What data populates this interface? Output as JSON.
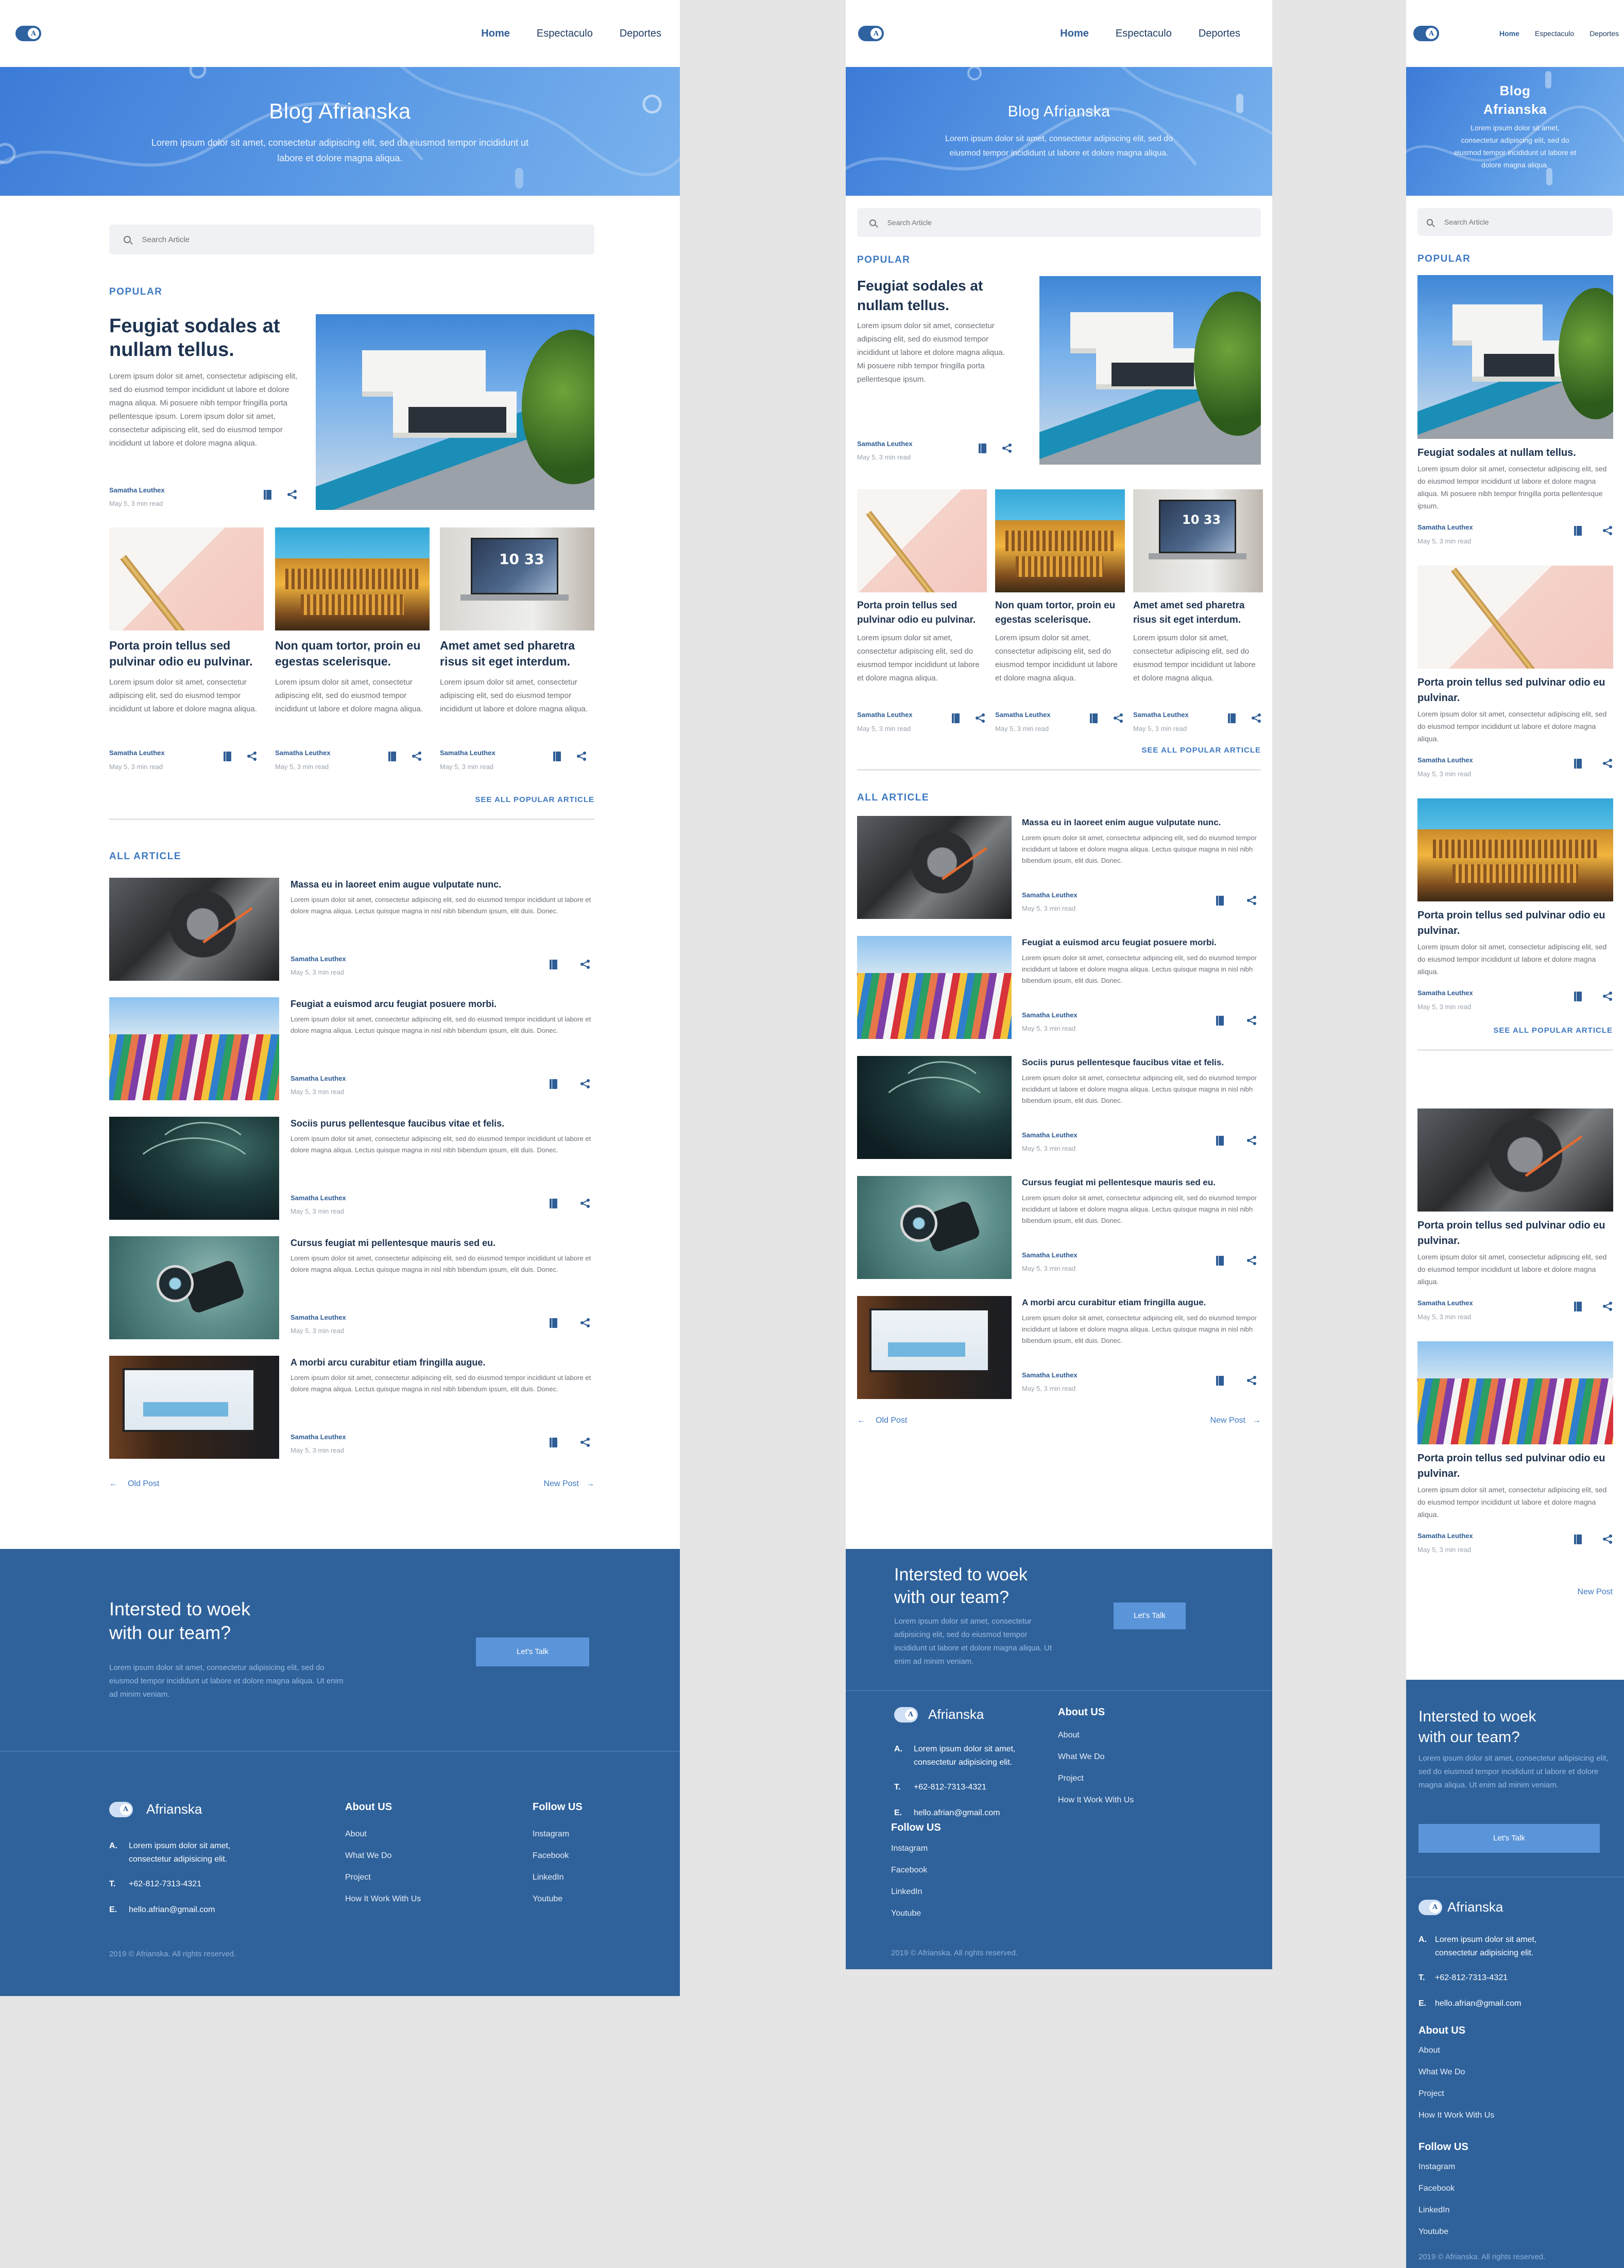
{
  "brand": {
    "name": "Afrianska",
    "logo_glyph": "A",
    "primary": "#2f629b",
    "accent": "#3d78c1"
  },
  "nav": {
    "items": [
      "Home",
      "Espectaculo",
      "Deportes"
    ],
    "active": "Home"
  },
  "hero": {
    "title": "Blog Afrianska",
    "subtitle": "Lorem ipsum dolor sit amet, consectetur adipiscing elit, sed do eiusmod tempor incididunt ut labore et dolore magna aliqua.",
    "mobile_title_line1": "Blog",
    "mobile_title_line2": "Afrianska"
  },
  "search": {
    "placeholder": "Search Article"
  },
  "popular": {
    "label": "POPULAR",
    "featured": {
      "title": "Feugiat sodales at nullam tellus.",
      "body_desktop": "Lorem ipsum dolor sit amet, consectetur adipiscing elit, sed do eiusmod tempor incididunt ut labore et dolore magna aliqua. Mi posuere nibh tempor fringilla porta pellentesque ipsum. Lorem ipsum dolor sit amet, consectetur adipiscing elit, sed do eiusmod tempor incididunt ut labore et dolore magna aliqua.",
      "body_tablet": "Lorem ipsum dolor sit amet, consectetur adipiscing elit, sed do eiusmod tempor incididunt ut labore et dolore magna aliqua. Mi posuere nibh tempor fringilla porta pellentesque ipsum.",
      "author": "Samatha Leuthex",
      "meta": "May 5, 3 min read",
      "image": "house"
    },
    "cards": [
      {
        "title": "Porta proin tellus sed pulvinar odio eu pulvinar.",
        "body": "Lorem ipsum dolor sit amet, consectetur adipiscing elit, sed do eiusmod tempor incididunt ut labore et dolore magna aliqua.",
        "author": "Samatha Leuthex",
        "meta": "May 5, 3 min read",
        "image": "pen"
      },
      {
        "title": "Non quam tortor, proin eu egestas scelerisque.",
        "body": "Lorem ipsum dolor sit amet, consectetur adipiscing elit, sed do eiusmod tempor incididunt ut labore et dolore magna aliqua.",
        "author": "Samatha Leuthex",
        "meta": "May 5, 3 min read",
        "image": "temple"
      },
      {
        "title": "Amet amet sed pharetra risus sit eget interdum.",
        "body": "Lorem ipsum dolor sit amet, consectetur adipiscing elit, sed do eiusmod tempor incididunt ut labore et dolore magna aliqua.",
        "author": "Samatha Leuthex",
        "meta": "May 5, 3 min read",
        "image": "laptop"
      }
    ],
    "see_all": "SEE ALL POPULAR ARTICLE"
  },
  "all_articles": {
    "label": "ALL ARTICLE",
    "items": [
      {
        "title": "Massa eu in laoreet enim augue vulputate nunc.",
        "body": "Lorem ipsum dolor sit amet, consectetur adipiscing elit, sed do eiusmod tempor incididunt ut labore et dolore magna aliqua. Lectus quisque magna in nisl nibh bibendum ipsum, elit duis. Donec.",
        "author": "Samatha Leuthex",
        "meta": "May 5, 3 min read",
        "image": "car"
      },
      {
        "title": "Feugiat a euismod arcu feugiat posuere morbi.",
        "body": "Lorem ipsum dolor sit amet, consectetur adipiscing elit, sed do eiusmod tempor incididunt ut labore et dolore magna aliqua. Lectus quisque magna in nisl nibh bibendum ipsum, elit duis. Donec.",
        "author": "Samatha Leuthex",
        "meta": "May 5, 3 min read",
        "image": "wall"
      },
      {
        "title": "Sociis purus pellentesque faucibus vitae et felis.",
        "body": "Lorem ipsum dolor sit amet, consectetur adipiscing elit, sed do eiusmod tempor incididunt ut labore et dolore magna aliqua. Lectus quisque magna in nisl nibh bibendum ipsum, elit duis. Donec.",
        "author": "Samatha Leuthex",
        "meta": "May 5, 3 min read",
        "image": "palm"
      },
      {
        "title": "Cursus feugiat mi pellentesque mauris sed eu.",
        "body": "Lorem ipsum dolor sit amet, consectetur adipiscing elit, sed do eiusmod tempor incididunt ut labore et dolore magna aliqua. Lectus quisque magna in nisl nibh bibendum ipsum, elit duis. Donec.",
        "author": "Samatha Leuthex",
        "meta": "May 5, 3 min read",
        "image": "water"
      },
      {
        "title": "A morbi arcu curabitur etiam fringilla augue.",
        "body": "Lorem ipsum dolor sit amet, consectetur adipiscing elit, sed do eiusmod tempor incididunt ut labore et dolore magna aliqua. Lectus quisque magna in nisl nibh bibendum ipsum, elit duis. Donec.",
        "author": "Samatha Leuthex",
        "meta": "May 5, 3 min read",
        "image": "dash"
      }
    ],
    "old_post": "Old Post",
    "new_post": "New Post"
  },
  "mobile_feed": {
    "featured_title": "Feugiat sodales at nullam tellus.",
    "featured_body": "Lorem ipsum dolor sit amet, consectetur adipiscing elit, sed do eiusmod tempor incididunt ut labore et dolore magna aliqua. Mi posuere nibh tempor fringilla porta pellentesque ipsum.",
    "card_title": "Porta proin tellus sed pulvinar odio eu pulvinar.",
    "card_body": "Lorem ipsum dolor sit amet, consectetur adipiscing elit, sed do eiusmod tempor incididunt ut labore et dolore magna aliqua.",
    "author": "Samatha Leuthex",
    "meta": "May 5, 3 min read"
  },
  "cta": {
    "title_line1": "Intersted to woek",
    "title_line2": "with our team?",
    "body": "Lorem ipsum dolor sit amet, consectetur adipisicing elit, sed do eiusmod tempor incididunt ut labore et dolore magna aliqua. Ut enim ad minim veniam.",
    "button": "Let's Talk"
  },
  "footer": {
    "address_label": "A.",
    "address": "Lorem ipsum dolor sit amet, consectetur adipisicing elit.",
    "phone_label": "T.",
    "phone": "+62-812-7313-4321",
    "email_label": "E.",
    "email": "hello.afrian@gmail.com",
    "about_heading": "About US",
    "about_links": [
      "About",
      "What We Do",
      "Project",
      "How It Work With Us"
    ],
    "follow_heading": "Follow US",
    "follow_links": [
      "Instagram",
      "Facebook",
      "LinkedIn",
      "Youtube"
    ],
    "copyright": "2019 © Afrianska. All rights reserved."
  }
}
